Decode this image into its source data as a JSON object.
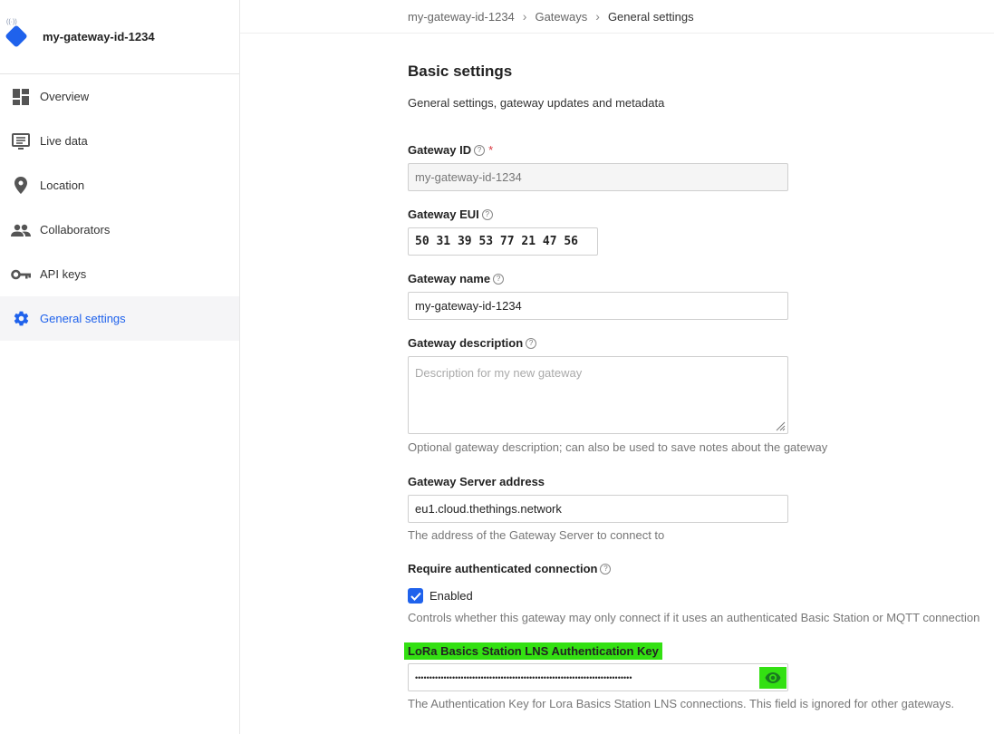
{
  "sidebar": {
    "title": "my-gateway-id-1234",
    "items": [
      {
        "label": "Overview",
        "icon": "dashboard-icon"
      },
      {
        "label": "Live data",
        "icon": "live-data-icon"
      },
      {
        "label": "Location",
        "icon": "location-pin-icon"
      },
      {
        "label": "Collaborators",
        "icon": "people-icon"
      },
      {
        "label": "API keys",
        "icon": "key-icon"
      },
      {
        "label": "General settings",
        "icon": "gear-icon",
        "active": true
      }
    ]
  },
  "breadcrumb": {
    "items": [
      "my-gateway-id-1234",
      "Gateways",
      "General settings"
    ]
  },
  "main": {
    "section_title": "Basic settings",
    "section_desc": "General settings, gateway updates and metadata",
    "gateway_id": {
      "label": "Gateway ID",
      "value": "my-gateway-id-1234",
      "required_mark": "*"
    },
    "gateway_eui": {
      "label": "Gateway EUI",
      "value": "50 31 39 53 77 21 47 56"
    },
    "gateway_name": {
      "label": "Gateway name",
      "value": "my-gateway-id-1234"
    },
    "gateway_description": {
      "label": "Gateway description",
      "placeholder": "Description for my new gateway",
      "help_text": "Optional gateway description; can also be used to save notes about the gateway"
    },
    "gateway_server": {
      "label": "Gateway Server address",
      "value": "eu1.cloud.thethings.network",
      "help_text": "The address of the Gateway Server to connect to"
    },
    "auth_connection": {
      "label": "Require authenticated connection",
      "checkbox_label": "Enabled",
      "checked": true,
      "help_text": "Controls whether this gateway may only connect if it uses an authenticated Basic Station or MQTT connection"
    },
    "lns_key": {
      "label": "LoRa Basics Station LNS Authentication Key",
      "value": "••••••••••••••••••••••••••••••••••••••••••••••••••••••••••••••••••••••••••••",
      "help_text": "The Authentication Key for Lora Basics Station LNS connections. This field is ignored for other gateways."
    }
  },
  "colors": {
    "accent": "#1f62ec",
    "highlight": "#33e012"
  }
}
